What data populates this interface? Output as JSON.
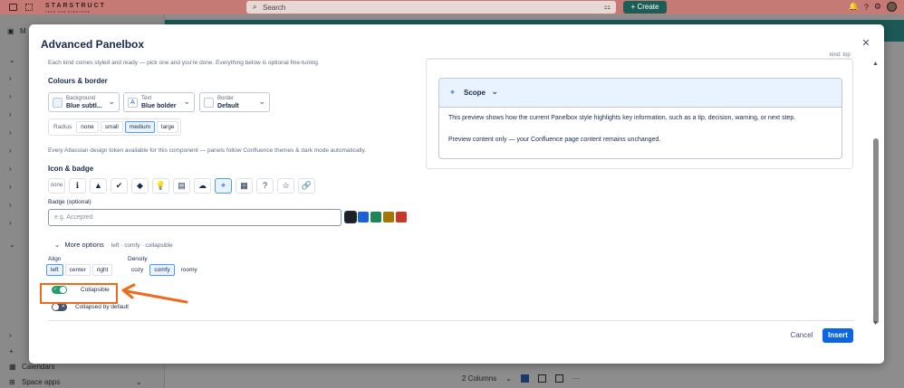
{
  "app": {
    "logo": "STARSTRUCT",
    "logo_tagline": "TECH FOR EVERYONE",
    "search_placeholder": "Search",
    "create_label": "+ Create",
    "space_initial": "M",
    "sidebar_bottom": [
      "Calendars",
      "Space apps"
    ],
    "layout_label": "2 Columns"
  },
  "modal": {
    "title": "Advanced Panelbox",
    "intro_hint": "Each kind comes styled and ready — pick one and you're done. Everything below is optional fine-tuning.",
    "colours": {
      "heading": "Colours & border",
      "dropdowns": [
        {
          "label": "Background",
          "value": "Blue subtl...",
          "glyph": ""
        },
        {
          "label": "Text",
          "value": "Blue bolder",
          "glyph": "A"
        },
        {
          "label": "Border",
          "value": "Default",
          "glyph": ""
        }
      ],
      "radius": {
        "label": "Radius",
        "options": [
          "none",
          "small",
          "medium",
          "large"
        ],
        "selected": "medium"
      },
      "token_hint": "Every Atlassian design token available for this component — panels follow Confluence themes & dark mode automatically."
    },
    "icon_badge": {
      "heading": "Icon & badge",
      "none_label": "none",
      "icons": [
        {
          "name": "info-icon",
          "glyph": "ℹ"
        },
        {
          "name": "warning-icon",
          "glyph": "▲"
        },
        {
          "name": "check-circle-icon",
          "glyph": "✔"
        },
        {
          "name": "error-diamond-icon",
          "glyph": "◆"
        },
        {
          "name": "lightbulb-icon",
          "glyph": "💡"
        },
        {
          "name": "book-icon",
          "glyph": "▤"
        },
        {
          "name": "cloud-hat-icon",
          "glyph": "☁"
        },
        {
          "name": "location-pin-icon",
          "glyph": "⌖"
        },
        {
          "name": "note-icon",
          "glyph": "▦"
        },
        {
          "name": "question-icon",
          "glyph": "?"
        },
        {
          "name": "star-icon",
          "glyph": "☆"
        },
        {
          "name": "link-icon",
          "glyph": "🔗"
        }
      ],
      "selected_icon": "location-pin-icon",
      "badge_label": "Badge (optional)",
      "badge_placeholder": "e.g. Accepted",
      "badge_value": "",
      "badge_colors": [
        "#1d2125",
        "#1d63d6",
        "#1f845a",
        "#a37700",
        "#c9372c"
      ],
      "selected_color": "#1d2125"
    },
    "more_options": {
      "label": "More options",
      "summary": "left · comfy · collapsible",
      "align": {
        "label": "Align",
        "options": [
          "left",
          "center",
          "right"
        ],
        "selected": "left"
      },
      "density": {
        "label": "Density",
        "options": [
          "cozy",
          "comfy",
          "roomy"
        ],
        "selected": "comfy"
      },
      "collapsible": {
        "label": "Collapsible",
        "on": true
      },
      "collapsed_default": {
        "label": "Collapsed by default",
        "on": false
      }
    },
    "preview": {
      "meta": "kind: top",
      "title": "Scope",
      "body_1": "This preview shows how the current Panelbox style highlights key information, such as a tip, decision, warning, or next step.",
      "body_2": "Preview content only — your Confluence page content remains unchanged."
    },
    "footer": {
      "cancel": "Cancel",
      "insert": "Insert"
    }
  },
  "colors": {
    "accent": "#0c66e4",
    "toggle_on": "#22a06b",
    "annotation": "#f06a1b"
  }
}
